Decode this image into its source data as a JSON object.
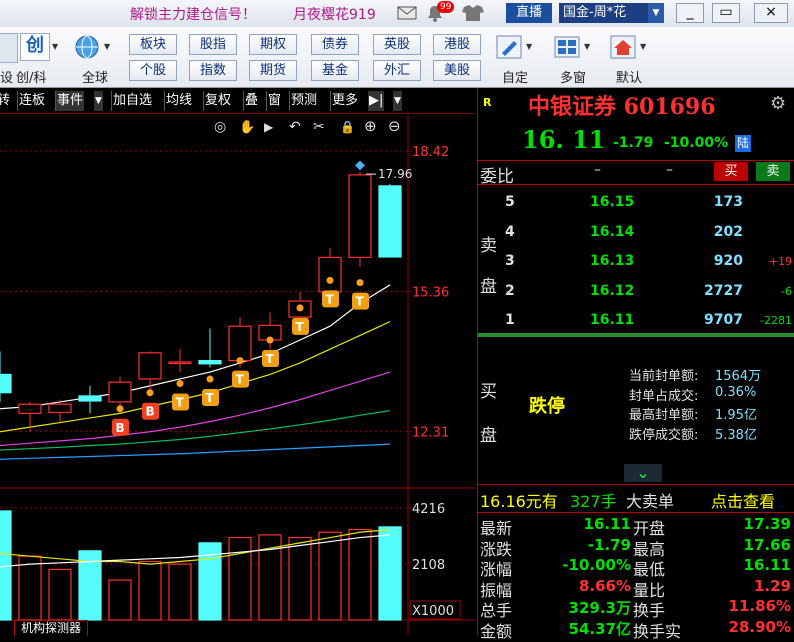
{
  "titlebar": {
    "ad_left": "解锁主力建仓信号！",
    "ad_right": "月夜樱花919",
    "notify_badge": "99",
    "live_button": "直播",
    "account_select": "国金-周*花",
    "minimize": "_",
    "restore": "▭",
    "close": "×"
  },
  "toolbar": {
    "left_labels": [
      "设",
      "创/科",
      "全球"
    ],
    "chuang_glyph": "创",
    "grid_row1": [
      "板块",
      "股指",
      "期权",
      "债券",
      "英股",
      "港股"
    ],
    "grid_row2": [
      "个股",
      "指数",
      "期货",
      "基金",
      "外汇",
      "美股"
    ],
    "right_labels": [
      "自定",
      "多窗",
      "默认"
    ]
  },
  "chart_tabs": [
    "转",
    "连板",
    "事件",
    "加自选",
    "均线",
    "复权",
    "叠",
    "窗",
    "预测",
    "更多"
  ],
  "chart_tools": {
    "eye": "◎",
    "hand": "✋",
    "play": "▶",
    "undo": "↶",
    "cut": "✂",
    "lock": "🔒",
    "zoom_in": "⊕",
    "zoom_out": "⊖"
  },
  "chart_data": [
    {
      "type": "candlestick",
      "ylim": [
        11.4,
        18.9
      ],
      "y_ticks": [
        "18.42",
        "15.36",
        "12.31"
      ],
      "y_tick_values": [
        18.42,
        15.36,
        12.31
      ],
      "max_label": "17.96",
      "candles": [
        {
          "o": 13.55,
          "h": 14.05,
          "l": 12.95,
          "c": 13.15,
          "color": "cyan"
        },
        {
          "o": 12.7,
          "h": 12.95,
          "l": 12.3,
          "c": 12.9,
          "color": "red"
        },
        {
          "o": 12.72,
          "h": 13.0,
          "l": 12.5,
          "c": 12.9,
          "color": "red"
        },
        {
          "o": 12.97,
          "h": 13.3,
          "l": 12.7,
          "c": 13.08,
          "color": "cyan"
        },
        {
          "o": 12.95,
          "h": 13.5,
          "l": 12.75,
          "c": 13.38,
          "color": "red"
        },
        {
          "o": 13.45,
          "h": 14.05,
          "l": 13.2,
          "c": 14.02,
          "color": "red"
        },
        {
          "o": 13.8,
          "h": 14.1,
          "l": 13.6,
          "c": 13.82,
          "color": "red"
        },
        {
          "o": 13.85,
          "h": 14.55,
          "l": 13.7,
          "c": 13.78,
          "color": "cyan"
        },
        {
          "o": 13.85,
          "h": 14.8,
          "l": 13.7,
          "c": 14.6,
          "color": "red"
        },
        {
          "o": 14.3,
          "h": 14.9,
          "l": 14.1,
          "c": 14.62,
          "color": "red"
        },
        {
          "o": 14.8,
          "h": 15.35,
          "l": 14.6,
          "c": 15.15,
          "color": "red"
        },
        {
          "o": 15.35,
          "h": 16.3,
          "l": 15.25,
          "c": 16.1,
          "color": "red"
        },
        {
          "o": 16.1,
          "h": 17.96,
          "l": 15.9,
          "c": 17.9,
          "color": "red"
        },
        {
          "o": 17.66,
          "h": 17.7,
          "l": 16.11,
          "c": 16.11,
          "color": "cyan"
        }
      ],
      "ma_lines": [
        {
          "name": "MA5",
          "color": "#ffffff",
          "values": [
            12.8,
            12.85,
            12.95,
            13.05,
            13.15,
            13.3,
            13.45,
            13.6,
            13.8,
            14.0,
            14.3,
            14.6,
            15.1,
            15.5
          ]
        },
        {
          "name": "MA10",
          "color": "#e6e600",
          "values": [
            12.3,
            12.4,
            12.5,
            12.6,
            12.7,
            12.85,
            13.0,
            13.15,
            13.35,
            13.55,
            13.8,
            14.1,
            14.4,
            14.7
          ]
        },
        {
          "name": "MA20",
          "color": "#e040e0",
          "values": [
            12.0,
            12.05,
            12.1,
            12.15,
            12.22,
            12.3,
            12.4,
            12.52,
            12.66,
            12.82,
            13.0,
            13.2,
            13.4,
            13.6
          ]
        },
        {
          "name": "MA30",
          "color": "#00c060",
          "values": [
            11.9,
            11.93,
            11.96,
            12.0,
            12.03,
            12.08,
            12.13,
            12.2,
            12.28,
            12.36,
            12.45,
            12.55,
            12.66,
            12.76
          ]
        },
        {
          "name": "MA60",
          "color": "#20a0ff",
          "values": [
            11.7,
            11.72,
            11.74,
            11.76,
            11.78,
            11.8,
            11.82,
            11.85,
            11.88,
            11.91,
            11.94,
            11.97,
            12.0,
            12.03
          ]
        }
      ],
      "signals": [
        {
          "index": 4,
          "label": "B",
          "price": 12.8
        },
        {
          "index": 5,
          "label": "B",
          "price": 13.15
        },
        {
          "index": 6,
          "label": "T",
          "price": 13.35
        },
        {
          "index": 7,
          "label": "T",
          "price": 13.45
        },
        {
          "index": 8,
          "label": "T",
          "price": 13.85
        },
        {
          "index": 9,
          "label": "T",
          "price": 14.3
        },
        {
          "index": 10,
          "label": "T",
          "price": 15.0
        },
        {
          "index": 11,
          "label": "T",
          "price": 15.6
        },
        {
          "index": 12,
          "label": "T",
          "price": 15.55
        }
      ]
    },
    {
      "type": "bar",
      "title": "volume",
      "y_ticks": [
        "4216",
        "2108"
      ],
      "y_tick_values": [
        4216,
        2108
      ],
      "ylim": [
        0,
        4700
      ],
      "unit_label": "X1000",
      "values": [
        4100,
        2400,
        1900,
        2600,
        1500,
        2200,
        2100,
        2900,
        3100,
        3200,
        3100,
        3300,
        3400,
        3500
      ],
      "colors": [
        "cyan",
        "red",
        "red",
        "cyan",
        "red",
        "red",
        "red",
        "cyan",
        "red",
        "red",
        "red",
        "red",
        "red",
        "cyan"
      ],
      "ma_lines": [
        {
          "name": "VMA5",
          "color": "#e6e600",
          "values": [
            2500,
            2400,
            2300,
            2200,
            2200,
            2100,
            2200,
            2300,
            2500,
            2700,
            2900,
            3100,
            3300,
            3400
          ]
        },
        {
          "name": "VMA10",
          "color": "#ffffff",
          "values": [
            2000,
            2100,
            2150,
            2200,
            2250,
            2300,
            2350,
            2450,
            2550,
            2650,
            2800,
            2950,
            3100,
            3200
          ]
        }
      ]
    }
  ],
  "quote": {
    "r_mark": "R",
    "name_code": "中银证券 601696",
    "price": "16. 11",
    "change": "-1.79",
    "change_pct": "-10.00%",
    "market_badge": "陆",
    "weibi_label": "委比",
    "weibi_dash1": "–",
    "weibi_dash2": "–",
    "buy_btn": "买",
    "sell_btn": "卖",
    "sell_side_label": [
      "卖",
      "盘"
    ],
    "sell_levels": [
      {
        "level": "5",
        "price": "16.15",
        "vol": "173",
        "chg": ""
      },
      {
        "level": "4",
        "price": "16.14",
        "vol": "202",
        "chg": ""
      },
      {
        "level": "3",
        "price": "16.13",
        "vol": "920",
        "chg": "+19"
      },
      {
        "level": "2",
        "price": "16.12",
        "vol": "2727",
        "chg": "-6"
      },
      {
        "level": "1",
        "price": "16.11",
        "vol": "9707",
        "chg": "-2281"
      }
    ],
    "buy_side_label": [
      "买",
      "盘"
    ],
    "limit_status": "跌停",
    "seal_stats": [
      {
        "label": "当前封单额:",
        "value": "1564万"
      },
      {
        "label": "封单占成交:",
        "value": "0.36%"
      },
      {
        "label": "最高封单额:",
        "value": "1.95亿"
      },
      {
        "label": "跌停成交额:",
        "value": "5.38亿"
      }
    ],
    "expand_arrow": "⌄",
    "bigorder": {
      "price": "16.16元有",
      "qty": "327手",
      "label": "大卖单",
      "link": "点击查看"
    },
    "stats": [
      {
        "l1": "最新",
        "v1": "16.11",
        "l2": "开盘",
        "v2": "17.39"
      },
      {
        "l1": "涨跌",
        "v1": "-1.79",
        "l2": "最高",
        "v2": "17.66"
      },
      {
        "l1": "涨幅",
        "v1": "-10.00%",
        "l2": "最低",
        "v2": "16.11"
      },
      {
        "l1": "振幅",
        "v1": "8.66%",
        "l2": "量比",
        "v2": "1.29"
      },
      {
        "l1": "总手",
        "v1": "329.3万",
        "l2": "换手",
        "v2": "11.86%"
      },
      {
        "l1": "金额",
        "v1": "54.37亿",
        "l2": "换手实",
        "v2": "28.90%"
      }
    ]
  },
  "bottom_tab": "机构探测器",
  "colors": {
    "up": "#ff3030",
    "down": "#00e000",
    "cyan_candle": "#54fcfc",
    "grid": "#9a0000"
  }
}
